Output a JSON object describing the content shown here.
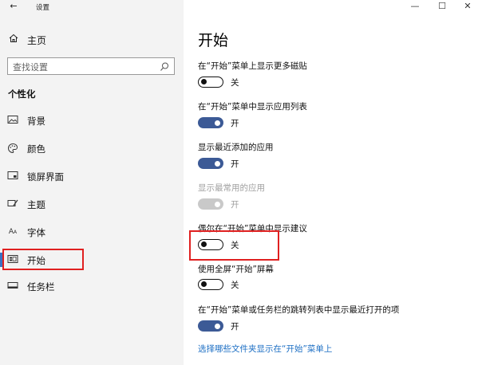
{
  "window": {
    "title": "设置",
    "back_icon": "arrow-left-icon",
    "controls": {
      "minimize": "—",
      "maximize": "☐",
      "close": "✕"
    }
  },
  "sidebar": {
    "home_label": "主页",
    "search_placeholder": "查找设置",
    "section_title": "个性化",
    "items": [
      {
        "label": "背景",
        "icon": "image-icon"
      },
      {
        "label": "颜色",
        "icon": "palette-icon"
      },
      {
        "label": "锁屏界面",
        "icon": "lock-screen-icon"
      },
      {
        "label": "主题",
        "icon": "theme-icon"
      },
      {
        "label": "字体",
        "icon": "font-icon"
      },
      {
        "label": "开始",
        "icon": "start-icon",
        "active": true
      },
      {
        "label": "任务栏",
        "icon": "taskbar-icon"
      }
    ]
  },
  "main": {
    "title": "开始",
    "settings": [
      {
        "label": "在“开始”菜单上显示更多磁贴",
        "state": "关",
        "on": false,
        "enabled": true
      },
      {
        "label": "在“开始”菜单中显示应用列表",
        "state": "开",
        "on": true,
        "enabled": true
      },
      {
        "label": "显示最近添加的应用",
        "state": "开",
        "on": true,
        "enabled": true
      },
      {
        "label": "显示最常用的应用",
        "state": "开",
        "on": true,
        "enabled": false
      },
      {
        "label": "偶尔在“开始”菜单中显示建议",
        "state": "关",
        "on": false,
        "enabled": true
      },
      {
        "label": "使用全屏“开始”屏幕",
        "state": "关",
        "on": false,
        "enabled": true
      },
      {
        "label": "在“开始”菜单或任务栏的跳转列表中显示最近打开的项",
        "state": "开",
        "on": true,
        "enabled": true
      }
    ],
    "link": "选择哪些文件夹显示在“开始”菜单上"
  },
  "colors": {
    "accent": "#3c5a96",
    "highlight": "#e02020",
    "link": "#1d6fc4",
    "sidebar_bg": "#f3f3f3"
  }
}
